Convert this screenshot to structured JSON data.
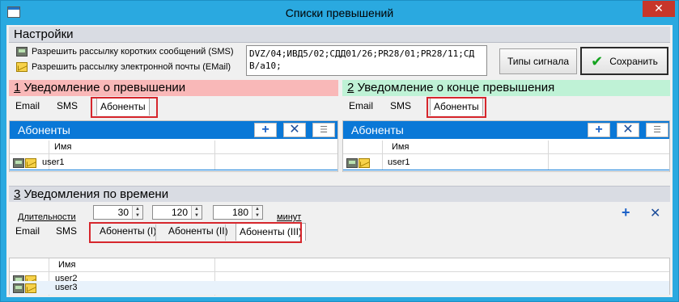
{
  "window": {
    "title": "Списки превышений",
    "close_glyph": "✕"
  },
  "settings": {
    "header": "Настройки",
    "sms_label": "Разрешить рассылку коротких сообщений (SMS)",
    "email_label": "Разрешить рассылку электронной почты (EMail)",
    "codes_text": "DVZ/04;ИВД5/02;СДД01/26;PR28/01;PR28/11;СДВ/a10;",
    "signal_types_button": "Типы сигнала",
    "save_button": "Сохранить"
  },
  "section1": {
    "num": "1",
    "title": " Уведомление о превышении",
    "tabs": [
      "Email",
      "SMS",
      "Абоненты"
    ],
    "grid_title": "Абоненты",
    "column": "Имя",
    "rows": [
      "user1"
    ]
  },
  "section2": {
    "num": "2",
    "title": " Уведомление о конце превышения",
    "tabs": [
      "Email",
      "SMS",
      "Абоненты"
    ],
    "grid_title": "Абоненты",
    "column": "Имя",
    "rows": [
      "user1"
    ]
  },
  "section3": {
    "num": "3",
    "title": " Уведомления по времени",
    "durations_label": "Длительности",
    "spins": [
      "30",
      "120",
      "180"
    ],
    "minutes_label": "минут",
    "tabs": [
      "Email",
      "SMS",
      "Абоненты (I)",
      "Абоненты (II)",
      "Абоненты (III)"
    ],
    "column": "Имя",
    "rows": [
      "user2",
      "user3"
    ]
  },
  "icons": {
    "add": "plus-icon",
    "delete": "x-icon",
    "list": "list-icon",
    "phone": "phone-icon",
    "mail": "mail-icon"
  },
  "colors": {
    "accent": "#0a78d7",
    "section1": "#f9b8b8",
    "section2": "#bff2d6",
    "highlight": "#d6262c"
  }
}
